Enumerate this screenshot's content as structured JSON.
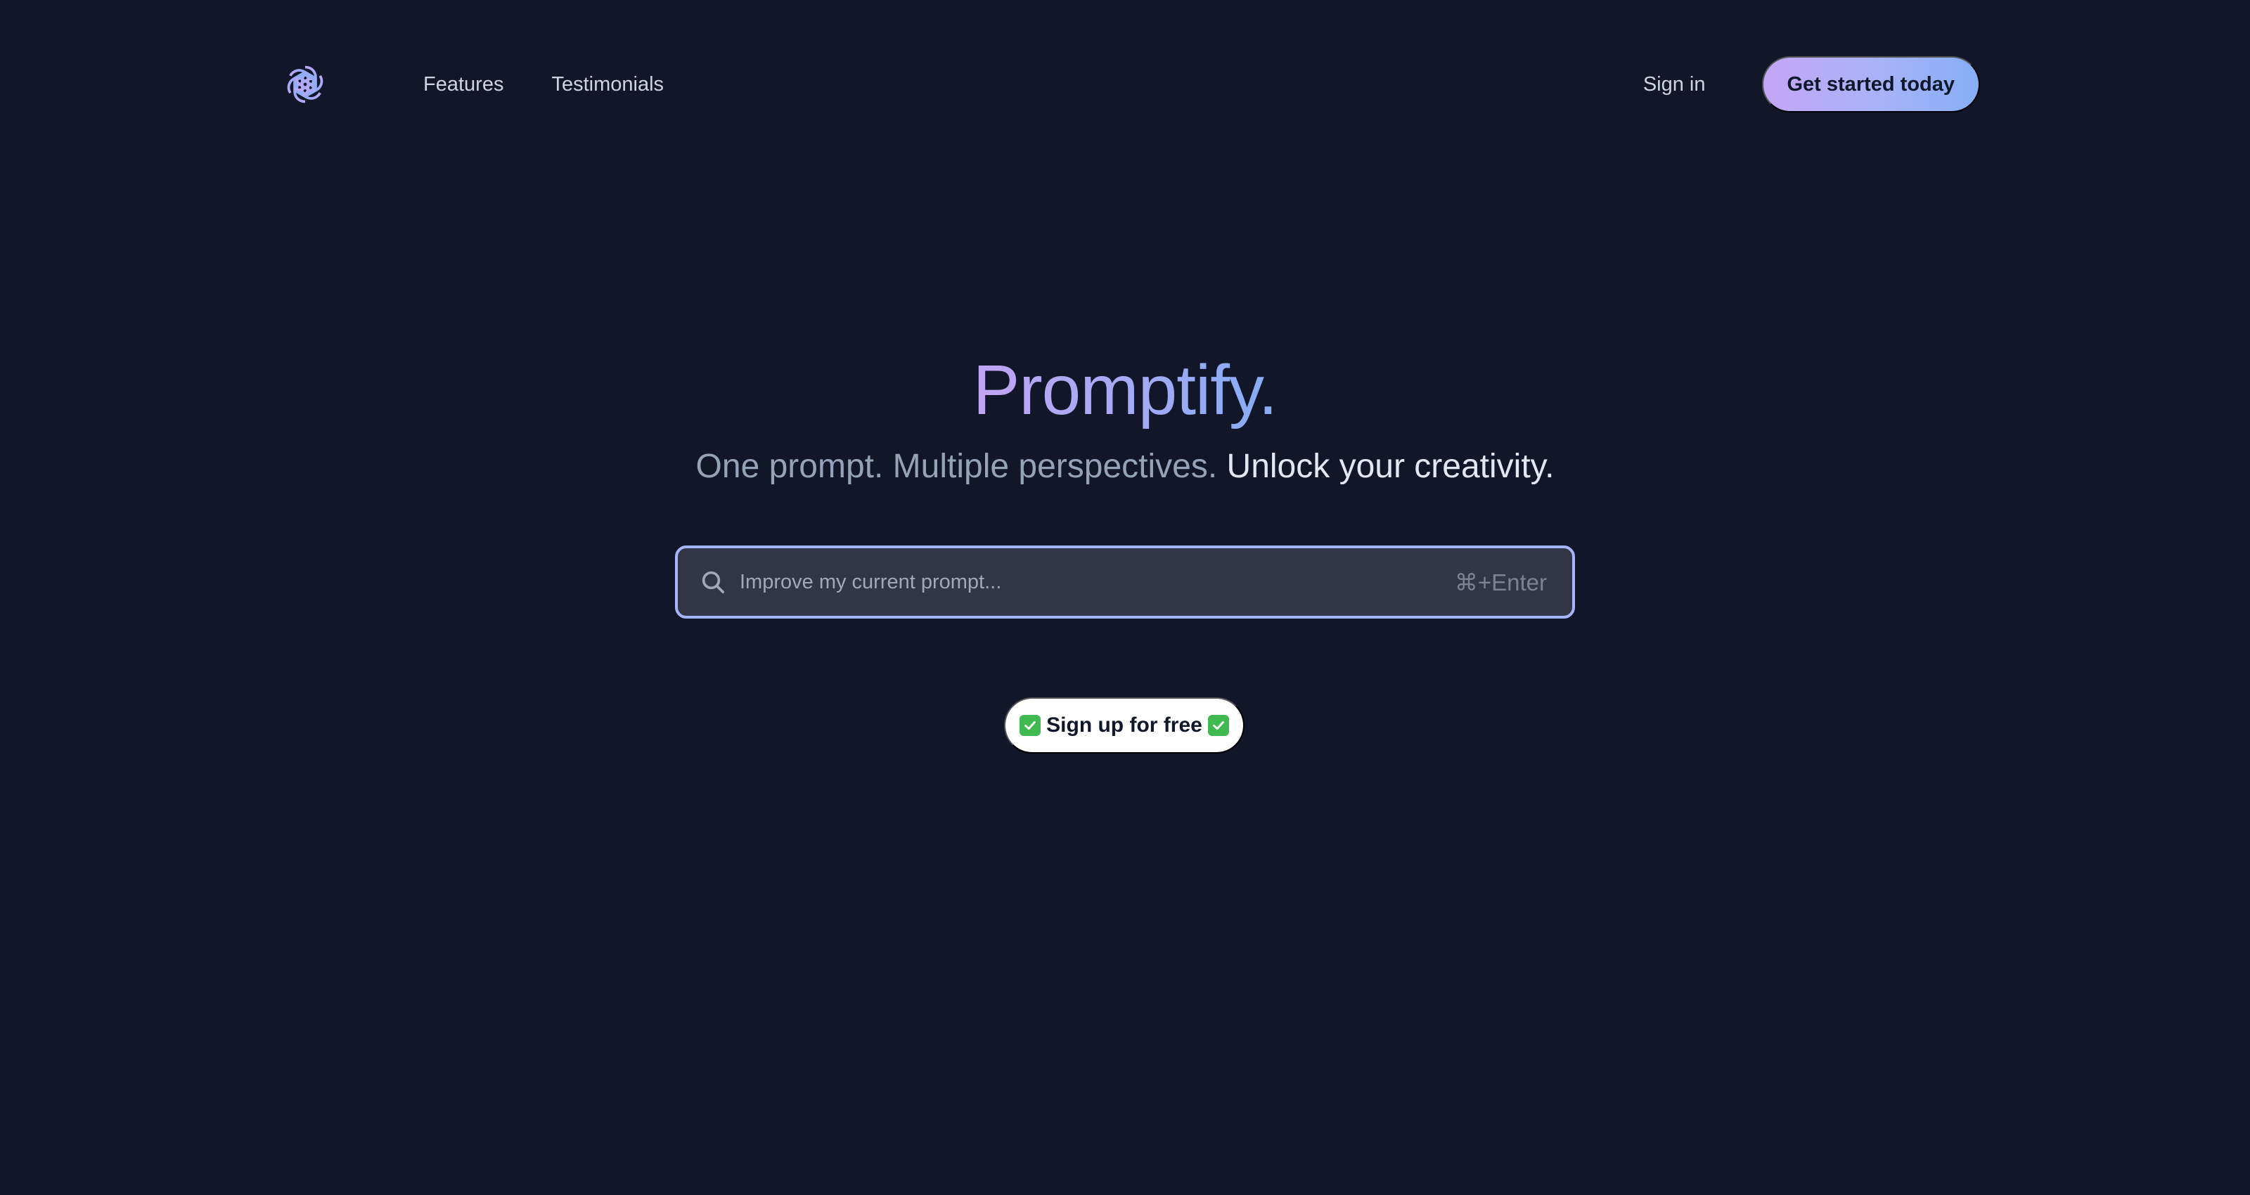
{
  "brand": {
    "logo_icon": "openai-knot-icon",
    "accent_gradient": [
      "#c4a6f6",
      "#86aef7"
    ],
    "background": "#111729"
  },
  "nav": {
    "links": [
      {
        "label": "Features"
      },
      {
        "label": "Testimonials"
      }
    ],
    "signin_label": "Sign in",
    "cta_label": "Get started today"
  },
  "hero": {
    "title": "Promptify.",
    "subtitle_part1": "One prompt. Multiple perspectives.",
    "subtitle_part2": "Unlock your creativity."
  },
  "search": {
    "icon": "search-icon",
    "placeholder": "Improve my current prompt...",
    "value": "",
    "shortcut": "⌘+Enter",
    "border_color": "#a5b4fc"
  },
  "signup": {
    "label": "Sign up for free",
    "icon": "check-mark-icon",
    "icon_color": "#3fb950"
  }
}
